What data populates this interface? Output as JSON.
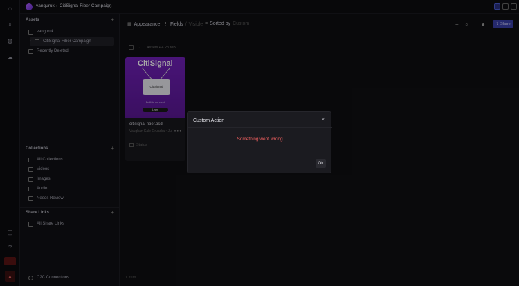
{
  "topbar": {
    "breadcrumb_root": "vanguruk",
    "breadcrumb_current": "CitiSignal Fiber Campaign",
    "breadcrumb_caret": "⌄",
    "breadcrumb_sep": "›"
  },
  "sidebar": {
    "assets_title": "Assets",
    "assets_items": [
      {
        "label": "vanguruk"
      },
      {
        "label": "CitiSignal Fiber Campaign"
      },
      {
        "label": "Recently Deleted"
      }
    ],
    "collections_title": "Collections",
    "collections_items": [
      {
        "label": "All Collections"
      },
      {
        "label": "Videos"
      },
      {
        "label": "Images"
      },
      {
        "label": "Audio"
      },
      {
        "label": "Needs Review"
      }
    ],
    "sharelinks_title": "Share Links",
    "sharelinks_items": [
      {
        "label": "All Share Links"
      }
    ],
    "c2c_label": "C2C Connections"
  },
  "toolbar": {
    "appearance": "Appearance",
    "fields": "Fields",
    "fields_state": "Visible",
    "sorted_by": "Sorted by",
    "sorted_value": "Custom",
    "share": "Share"
  },
  "main": {
    "assets_count": "1 Assets • 4.23 MB",
    "footer_count": "1 Item"
  },
  "card": {
    "thumb_brand": "CitiSignal",
    "thumb_router_label": "CitiSignal",
    "thumb_caption": "Built to connect",
    "thumb_pill": "Learn",
    "name": "citisignal-fiber.psd",
    "meta": "Vaughan Kale Gruszka • Jul",
    "status": "Status"
  },
  "modal": {
    "title": "Custom Action",
    "close": "×",
    "error": "Something went wrong",
    "ok": "Ok"
  }
}
